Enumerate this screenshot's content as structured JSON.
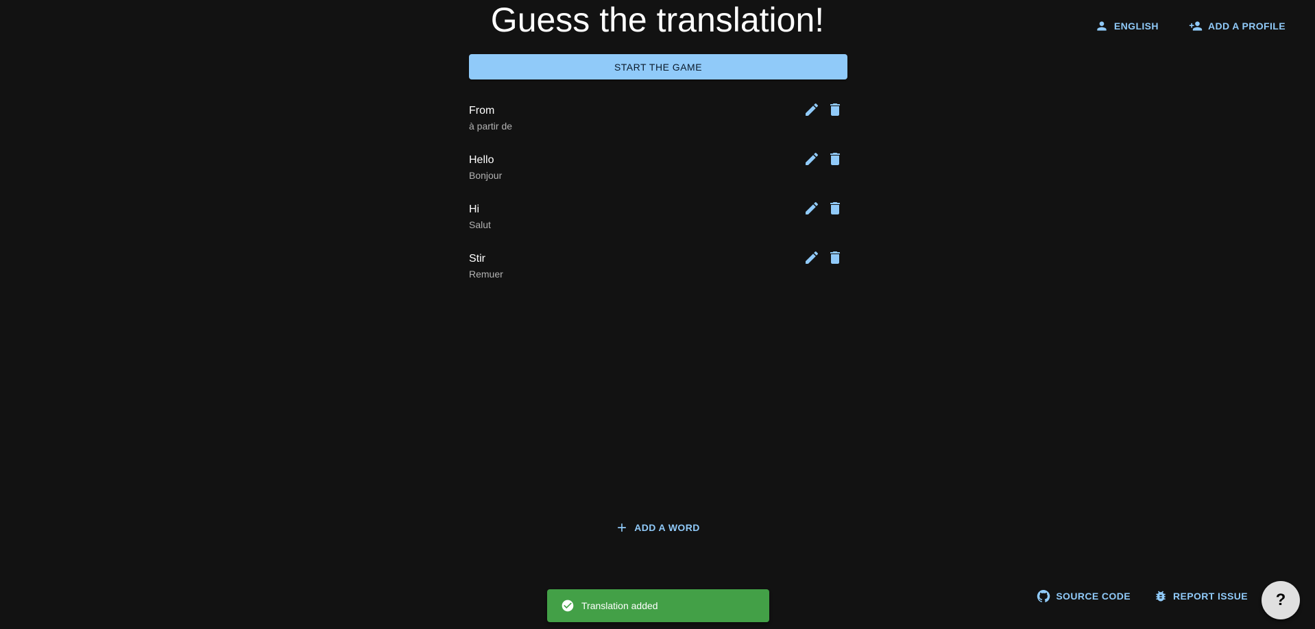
{
  "header": {
    "title": "Guess the translation!",
    "language_label": "ENGLISH",
    "add_profile_label": "ADD A PROFILE"
  },
  "main": {
    "start_label": "START THE GAME",
    "words": [
      {
        "word": "From",
        "translation": "à partir de"
      },
      {
        "word": "Hello",
        "translation": "Bonjour"
      },
      {
        "word": "Hi",
        "translation": "Salut"
      },
      {
        "word": "Stir",
        "translation": "Remuer"
      }
    ],
    "add_word_label": "ADD A WORD"
  },
  "snackbar": {
    "message": "Translation added"
  },
  "footer": {
    "source_code_label": "SOURCE CODE",
    "report_issue_label": "REPORT ISSUE",
    "help_label": "?"
  },
  "colors": {
    "background": "#121212",
    "accent": "#90caf9",
    "success": "#43a047"
  }
}
